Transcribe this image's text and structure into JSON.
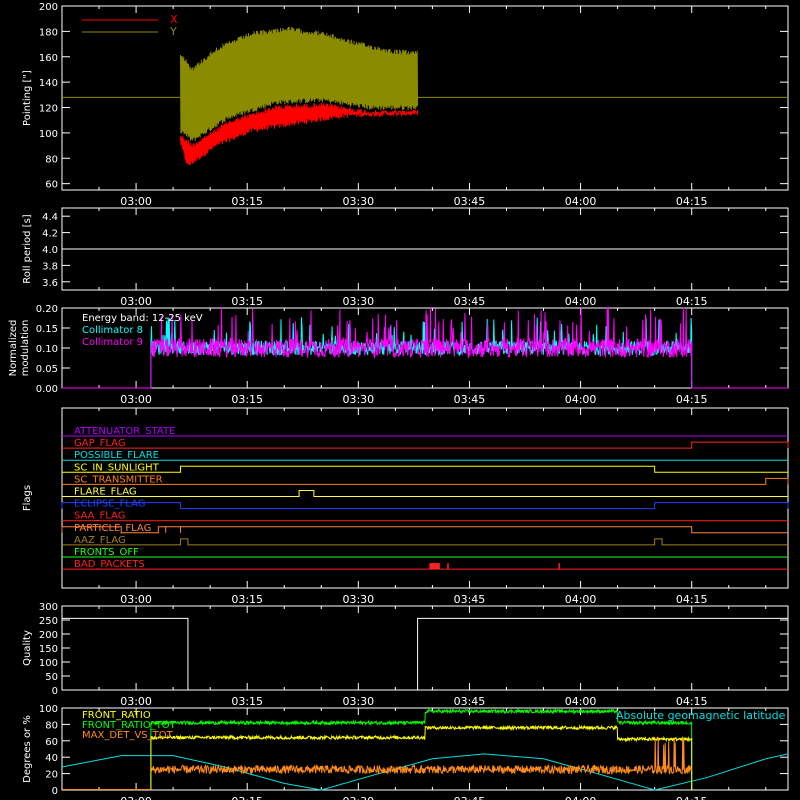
{
  "chart_data": {
    "type": "line",
    "time_ticks": [
      "03:00",
      "03:15",
      "03:30",
      "03:45",
      "04:00",
      "04:15"
    ],
    "time_range_hhmm": [
      "02:50",
      "04:28"
    ],
    "panels": [
      {
        "id": "pointing",
        "ylabel": "Pointing [\"]",
        "ylim": [
          55,
          200
        ],
        "yticks": [
          60,
          80,
          100,
          120,
          140,
          160,
          180,
          200
        ],
        "legend": [
          {
            "name": "X",
            "color": "#ff0000"
          },
          {
            "name": "Y",
            "color": "#8b8b00"
          }
        ],
        "series": [
          {
            "name": "Y",
            "color": "#8b8b00",
            "span": [
              "03:06",
              "03:38"
            ],
            "upper_envelope": [
              [
                0.0,
                165
              ],
              [
                0.05,
                152
              ],
              [
                0.15,
                168
              ],
              [
                0.3,
                180
              ],
              [
                0.45,
                184
              ],
              [
                0.6,
                180
              ],
              [
                0.75,
                172
              ],
              [
                0.9,
                166
              ],
              [
                1.0,
                165
              ]
            ],
            "lower_envelope": [
              [
                0.0,
                100
              ],
              [
                0.05,
                92
              ],
              [
                0.2,
                110
              ],
              [
                0.4,
                122
              ],
              [
                0.6,
                124
              ],
              [
                0.8,
                118
              ],
              [
                1.0,
                118
              ]
            ]
          },
          {
            "name": "X",
            "color": "#ff0000",
            "span": [
              "03:06",
              "03:38"
            ],
            "upper_envelope": [
              [
                0.0,
                100
              ],
              [
                0.05,
                92
              ],
              [
                0.2,
                110
              ],
              [
                0.4,
                122
              ],
              [
                0.6,
                124
              ],
              [
                0.8,
                118
              ],
              [
                1.0,
                118
              ]
            ],
            "lower_envelope": [
              [
                0.0,
                90
              ],
              [
                0.03,
                72
              ],
              [
                0.15,
                88
              ],
              [
                0.3,
                100
              ],
              [
                0.5,
                106
              ],
              [
                0.7,
                112
              ],
              [
                0.85,
                113
              ],
              [
                1.0,
                114
              ]
            ]
          }
        ],
        "reference_line": {
          "y": 128,
          "color": "#8b8b00"
        }
      },
      {
        "id": "roll",
        "ylabel": "Roll period [s]",
        "ylim": [
          3.5,
          4.5
        ],
        "yticks": [
          3.6,
          3.8,
          4.0,
          4.2,
          4.4
        ],
        "series": [
          {
            "name": "",
            "color": "#ffffff",
            "constant": 4.0
          }
        ]
      },
      {
        "id": "modulation",
        "ylabel": "Normalized modulation",
        "ylim": [
          0,
          0.2
        ],
        "yticks": [
          0.0,
          0.05,
          0.1,
          0.15,
          0.2
        ],
        "annotation": "Energy band: 12-25 keV",
        "legend": [
          {
            "name": "Collimator 8",
            "color": "#00ffff"
          },
          {
            "name": "Collimator 9",
            "color": "#ff00ff"
          }
        ],
        "series": [
          {
            "name": "Collimator 8",
            "color": "#00ffff",
            "span": [
              "03:02",
              "04:15"
            ],
            "mean": 0.1,
            "spread": 0.03
          },
          {
            "name": "Collimator 9",
            "color": "#ff00ff",
            "span": [
              "03:02",
              "04:15"
            ],
            "mean": 0.1,
            "spread": 0.04
          }
        ]
      },
      {
        "id": "flags",
        "ylabel": "Flags",
        "flags": [
          {
            "name": "ATTENUATOR_STATE",
            "color": "#b000ff",
            "high": []
          },
          {
            "name": "GAP_FLAG",
            "color": "#ff2020",
            "high": [
              [
                "04:15",
                "04:28"
              ]
            ]
          },
          {
            "name": "POSSIBLE_FLARE",
            "color": "#00e0e0",
            "high": []
          },
          {
            "name": "SC_IN_SUNLIGHT",
            "color": "#ffff00",
            "high": [
              [
                "03:06",
                "04:10"
              ]
            ]
          },
          {
            "name": "SC_TRANSMITTER",
            "color": "#ff7f20",
            "high": [
              [
                "04:25",
                "04:28"
              ]
            ]
          },
          {
            "name": "FLARE_FLAG",
            "color": "#ffff40",
            "high": [
              [
                "03:22",
                "03:24"
              ]
            ]
          },
          {
            "name": "ECLIPSE_FLAG",
            "color": "#2040ff",
            "high": [
              [
                "02:50",
                "03:06"
              ],
              [
                "04:10",
                "04:28"
              ]
            ]
          },
          {
            "name": "SAA_FLAG",
            "color": "#ff2020",
            "high": []
          },
          {
            "name": "PARTICLE_FLAG",
            "color": "#ff8040",
            "high": [
              [
                "02:50",
                "02:58"
              ],
              [
                "03:03",
                "03:04"
              ],
              [
                "03:04",
                "03:06"
              ],
              [
                "03:06",
                "04:15"
              ]
            ]
          },
          {
            "name": "AAZ_FLAG",
            "color": "#a08020",
            "high": [
              [
                "03:06",
                "03:07"
              ],
              [
                "04:10",
                "04:11"
              ]
            ]
          },
          {
            "name": "FRONTS_OFF",
            "color": "#20ff20",
            "high": []
          },
          {
            "name": "BAD_PACKETS",
            "color": "#ff2020",
            "high": [
              [
                "03:40",
                "03:40"
              ],
              [
                "03:40",
                "03:41"
              ],
              [
                "03:42",
                "03:42"
              ],
              [
                "03:57",
                "03:57"
              ]
            ]
          }
        ]
      },
      {
        "id": "quality",
        "ylabel": "Quality",
        "ylim": [
          0,
          300
        ],
        "yticks": [
          0,
          50,
          100,
          150,
          200,
          250,
          300
        ],
        "series": [
          {
            "name": "",
            "color": "#ffffff",
            "steps": [
              [
                "02:50",
                256
              ],
              [
                "03:07",
                0
              ],
              [
                "03:38",
                256
              ],
              [
                "04:28",
                256
              ]
            ]
          }
        ]
      },
      {
        "id": "geo",
        "ylabel": "Degrees or %",
        "ylim": [
          0,
          100
        ],
        "yticks": [
          0,
          20,
          40,
          60,
          80,
          100
        ],
        "legend": [
          {
            "name": "FRONT_RATIO",
            "color": "#ffff00"
          },
          {
            "name": "FRONT_RATIO_TOT",
            "color": "#00ff00"
          },
          {
            "name": "MAX_DET_VS_TOT",
            "color": "#ff8c1a"
          }
        ],
        "annotation": "Absolute geomagnetic latitude",
        "annotation_color": "#00e0e0",
        "series": [
          {
            "name": "FRONT_RATIO_TOT",
            "color": "#00ff00",
            "span": [
              "03:02",
              "04:15"
            ],
            "levels": [
              [
                "03:02",
                82
              ],
              [
                "03:39",
                82
              ],
              [
                "03:39",
                96
              ],
              [
                "04:05",
                96
              ],
              [
                "04:05",
                82
              ],
              [
                "04:15",
                82
              ]
            ]
          },
          {
            "name": "FRONT_RATIO",
            "color": "#ffff00",
            "span": [
              "03:02",
              "04:15"
            ],
            "levels": [
              [
                "03:02",
                64
              ],
              [
                "03:39",
                64
              ],
              [
                "03:39",
                76
              ],
              [
                "04:05",
                76
              ],
              [
                "04:05",
                62
              ],
              [
                "04:15",
                62
              ]
            ]
          },
          {
            "name": "MAX_DET_VS_TOT",
            "color": "#ff8c1a",
            "span": [
              "03:02",
              "04:15"
            ],
            "mean": 25,
            "spread": 5
          },
          {
            "name": "Absolute geomagnetic latitude",
            "color": "#00e0e0",
            "points": [
              [
                "02:50",
                28
              ],
              [
                "02:58",
                42
              ],
              [
                "03:05",
                42
              ],
              [
                "03:12",
                28
              ],
              [
                "03:20",
                8
              ],
              [
                "03:25",
                0
              ],
              [
                "03:32",
                18
              ],
              [
                "03:40",
                38
              ],
              [
                "03:47",
                44
              ],
              [
                "03:55",
                38
              ],
              [
                "04:03",
                18
              ],
              [
                "04:10",
                0
              ],
              [
                "04:17",
                15
              ],
              [
                "04:25",
                38
              ],
              [
                "04:28",
                44
              ]
            ]
          }
        ]
      }
    ]
  }
}
